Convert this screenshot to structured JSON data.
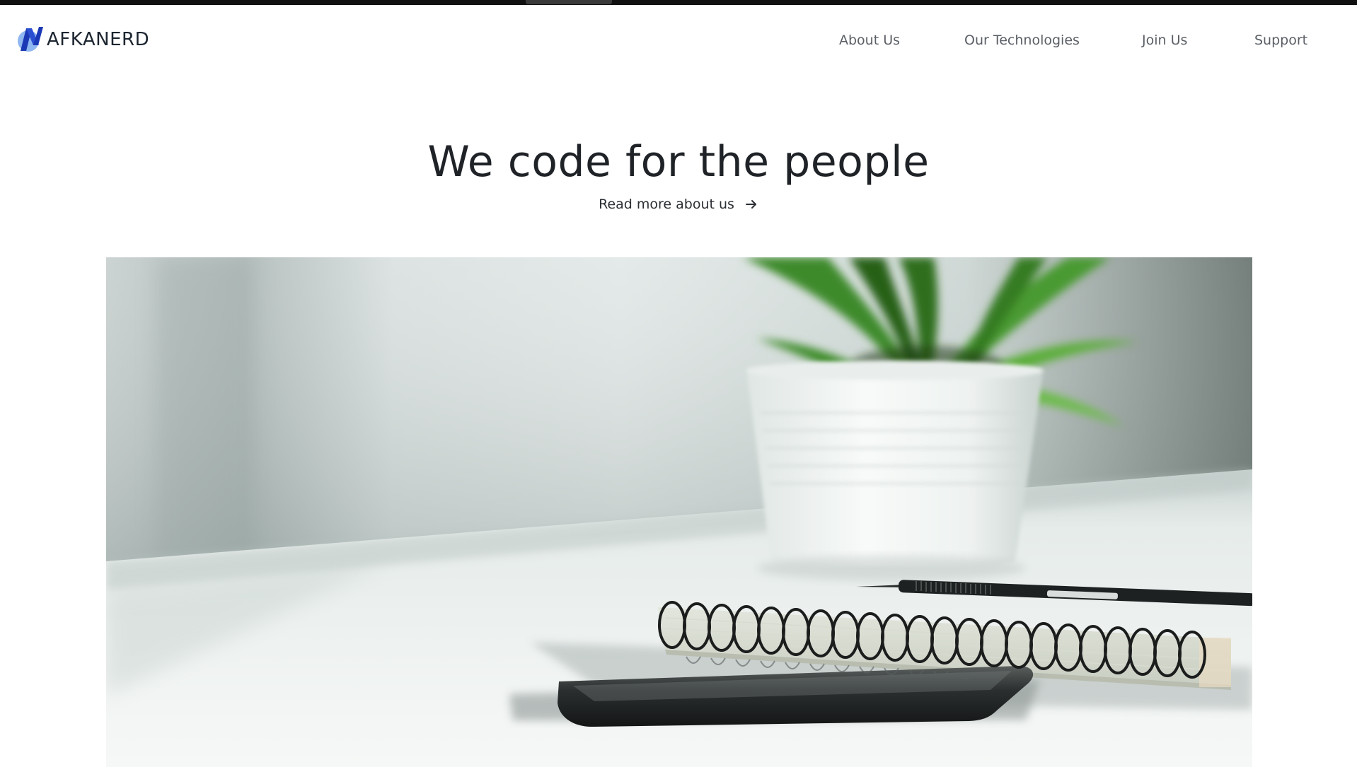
{
  "brand": {
    "name": "AFKANERD",
    "logo_icon": "afkanerd-logo-icon",
    "colors": {
      "primary": "#1b39b5",
      "secondary": "#5b8ee0"
    }
  },
  "nav": {
    "items": [
      {
        "label": "About Us"
      },
      {
        "label": "Our Technologies"
      },
      {
        "label": "Join Us"
      },
      {
        "label": "Support"
      }
    ]
  },
  "hero": {
    "title": "We code for the people",
    "link_label": "Read more about us",
    "link_icon": "arrow-right-icon",
    "image_subject": "desk-plant-notebook-phone-photo"
  }
}
